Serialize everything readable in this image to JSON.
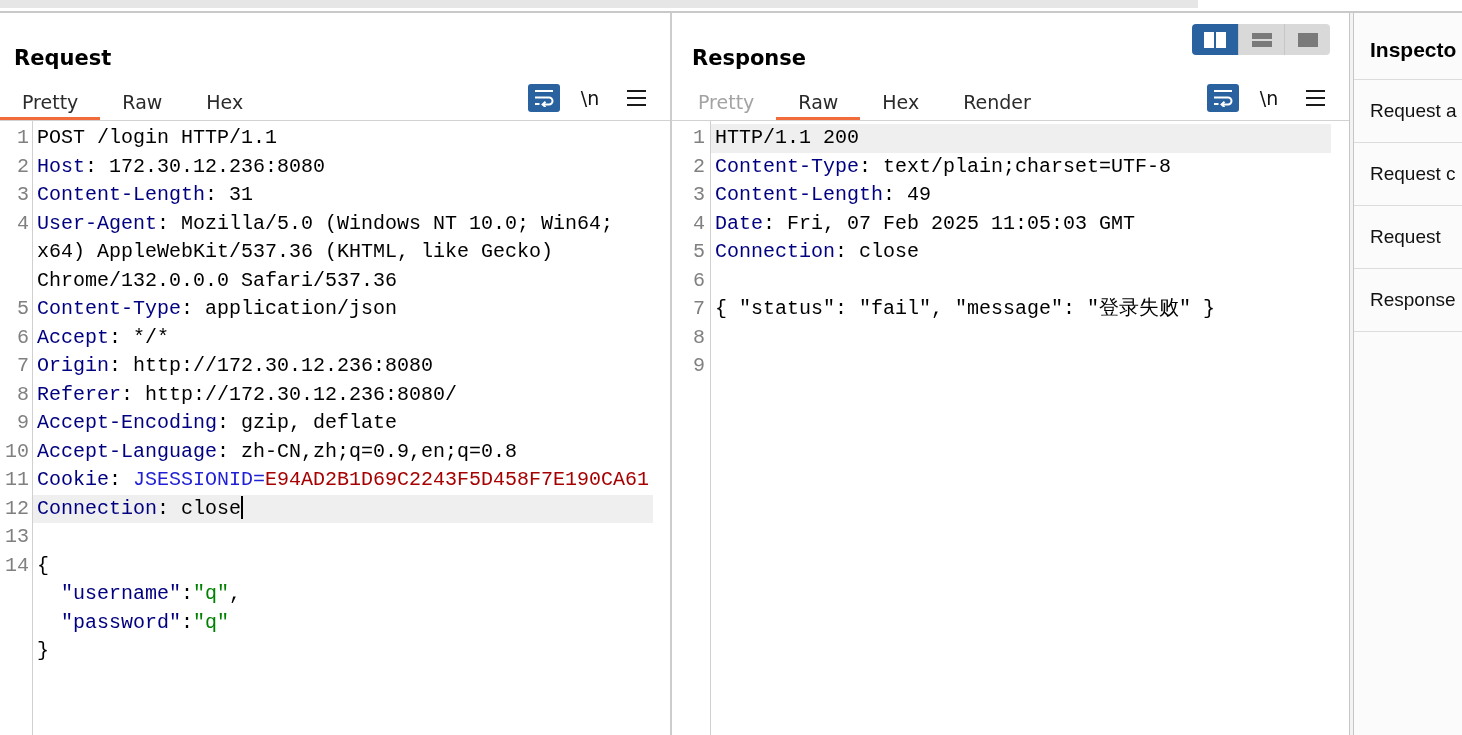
{
  "request": {
    "title": "Request",
    "tabs": [
      {
        "label": "Pretty",
        "selected": true
      },
      {
        "label": "Raw",
        "selected": false
      },
      {
        "label": "Hex",
        "selected": false
      }
    ],
    "toolbar": [
      {
        "kind": "wrap",
        "on": true
      },
      {
        "kind": "newlines",
        "label": "\\n",
        "on": false
      },
      {
        "kind": "menu"
      }
    ],
    "editor": {
      "lines": [
        {
          "number": "1",
          "current": false,
          "cursor": false,
          "tokens": [
            {
              "kind": "plain",
              "text": "POST /login HTTP/1.1"
            }
          ]
        },
        {
          "number": "2",
          "current": false,
          "cursor": false,
          "tokens": [
            {
              "kind": "name",
              "text": "Host"
            },
            {
              "kind": "plain",
              "text": ": 172.30.12.236:8080"
            }
          ]
        },
        {
          "number": "3",
          "current": false,
          "cursor": false,
          "tokens": [
            {
              "kind": "name",
              "text": "Content-Length"
            },
            {
              "kind": "plain",
              "text": ": 31"
            }
          ]
        },
        {
          "number": "4",
          "current": false,
          "cursor": false,
          "tokens": [
            {
              "kind": "name",
              "text": "User-Agent"
            },
            {
              "kind": "plain",
              "text": ": Mozilla/5.0 (Windows NT 10.0; Win64; x64) AppleWebKit/537.36 (KHTML, like Gecko) Chrome/132.0.0.0 Safari/537.36"
            }
          ]
        },
        {
          "number": "5",
          "current": false,
          "cursor": false,
          "tokens": [
            {
              "kind": "name",
              "text": "Content-Type"
            },
            {
              "kind": "plain",
              "text": ": application/json"
            }
          ]
        },
        {
          "number": "6",
          "current": false,
          "cursor": false,
          "tokens": [
            {
              "kind": "name",
              "text": "Accept"
            },
            {
              "kind": "plain",
              "text": ": */*"
            }
          ]
        },
        {
          "number": "7",
          "current": false,
          "cursor": false,
          "tokens": [
            {
              "kind": "name",
              "text": "Origin"
            },
            {
              "kind": "plain",
              "text": ": http://172.30.12.236:8080"
            }
          ]
        },
        {
          "number": "8",
          "current": false,
          "cursor": false,
          "tokens": [
            {
              "kind": "name",
              "text": "Referer"
            },
            {
              "kind": "plain",
              "text": ": http://172.30.12.236:8080/"
            }
          ]
        },
        {
          "number": "9",
          "current": false,
          "cursor": false,
          "tokens": [
            {
              "kind": "name",
              "text": "Accept-Encoding"
            },
            {
              "kind": "plain",
              "text": ": gzip, deflate"
            }
          ]
        },
        {
          "number": "10",
          "current": false,
          "cursor": false,
          "tokens": [
            {
              "kind": "name",
              "text": "Accept-Language"
            },
            {
              "kind": "plain",
              "text": ": zh-CN,zh;q=0.9,en;q=0.8"
            }
          ]
        },
        {
          "number": "11",
          "current": false,
          "cursor": false,
          "tokens": [
            {
              "kind": "name",
              "text": "Cookie"
            },
            {
              "kind": "plain",
              "text": ": "
            },
            {
              "kind": "cookie_name",
              "text": "JSESSIONID="
            },
            {
              "kind": "cookie_value",
              "text": "E94AD2B1D69C2243F5D458F7E190CA61"
            }
          ]
        },
        {
          "number": "12",
          "current": true,
          "cursor": true,
          "tokens": [
            {
              "kind": "name",
              "text": "Connection"
            },
            {
              "kind": "plain",
              "text": ": close"
            }
          ]
        },
        {
          "number": "13",
          "current": false,
          "cursor": false
        },
        {
          "number": "14",
          "current": false,
          "cursor": false,
          "tokens": [
            {
              "kind": "plain",
              "text": "{"
            }
          ]
        },
        {
          "current": false,
          "cursor": false,
          "tokens": [
            {
              "kind": "name",
              "text": "  \"username\""
            },
            {
              "kind": "plain",
              "text": ":"
            },
            {
              "kind": "string",
              "text": "\"q\""
            },
            {
              "kind": "plain",
              "text": ","
            }
          ]
        },
        {
          "current": false,
          "cursor": false,
          "tokens": [
            {
              "kind": "name",
              "text": "  \"password\""
            },
            {
              "kind": "plain",
              "text": ":"
            },
            {
              "kind": "string",
              "text": "\"q\""
            }
          ]
        },
        {
          "current": false,
          "cursor": false,
          "tokens": [
            {
              "kind": "plain",
              "text": "}"
            }
          ]
        }
      ]
    }
  },
  "response": {
    "title": "Response",
    "layout_buttons": [
      {
        "kind": "columns",
        "selected": true
      },
      {
        "kind": "rows",
        "selected": false
      },
      {
        "kind": "single",
        "selected": false
      }
    ],
    "tabs": [
      {
        "label": "Pretty",
        "selected": false,
        "disabled": true
      },
      {
        "label": "Raw",
        "selected": true,
        "disabled": false
      },
      {
        "label": "Hex",
        "selected": false,
        "disabled": false
      },
      {
        "label": "Render",
        "selected": false,
        "disabled": false
      }
    ],
    "toolbar": [
      {
        "kind": "wrap",
        "on": true
      },
      {
        "kind": "newlines",
        "label": "\\n",
        "on": false
      },
      {
        "kind": "menu"
      }
    ],
    "editor": {
      "lines": [
        {
          "number": "1",
          "current": true,
          "cursor": false,
          "tokens": [
            {
              "kind": "plain",
              "text": "HTTP/1.1 200"
            }
          ]
        },
        {
          "number": "2",
          "current": false,
          "cursor": false,
          "tokens": [
            {
              "kind": "name",
              "text": "Content-Type"
            },
            {
              "kind": "plain",
              "text": ": text/plain;charset=UTF-8"
            }
          ]
        },
        {
          "number": "3",
          "current": false,
          "cursor": false,
          "tokens": [
            {
              "kind": "name",
              "text": "Content-Length"
            },
            {
              "kind": "plain",
              "text": ": 49"
            }
          ]
        },
        {
          "number": "4",
          "current": false,
          "cursor": false,
          "tokens": [
            {
              "kind": "name",
              "text": "Date"
            },
            {
              "kind": "plain",
              "text": ": Fri, 07 Feb 2025 11:05:03 GMT"
            }
          ]
        },
        {
          "number": "5",
          "current": false,
          "cursor": false,
          "tokens": [
            {
              "kind": "name",
              "text": "Connection"
            },
            {
              "kind": "plain",
              "text": ": close"
            }
          ]
        },
        {
          "number": "6",
          "current": false,
          "cursor": false
        },
        {
          "number": "7",
          "current": false,
          "cursor": false,
          "tokens": [
            {
              "kind": "plain",
              "text": "{ \"status\": \"fail\", \"message\": \"登录失败\" }"
            }
          ]
        },
        {
          "number": "8",
          "current": false,
          "cursor": false
        },
        {
          "number": "9",
          "current": false,
          "cursor": false
        }
      ]
    }
  },
  "inspector": {
    "title": "Inspecto",
    "sections": [
      {
        "label": "Request a"
      },
      {
        "label": "Request c"
      },
      {
        "label": "Request"
      },
      {
        "label": "Response"
      }
    ]
  }
}
